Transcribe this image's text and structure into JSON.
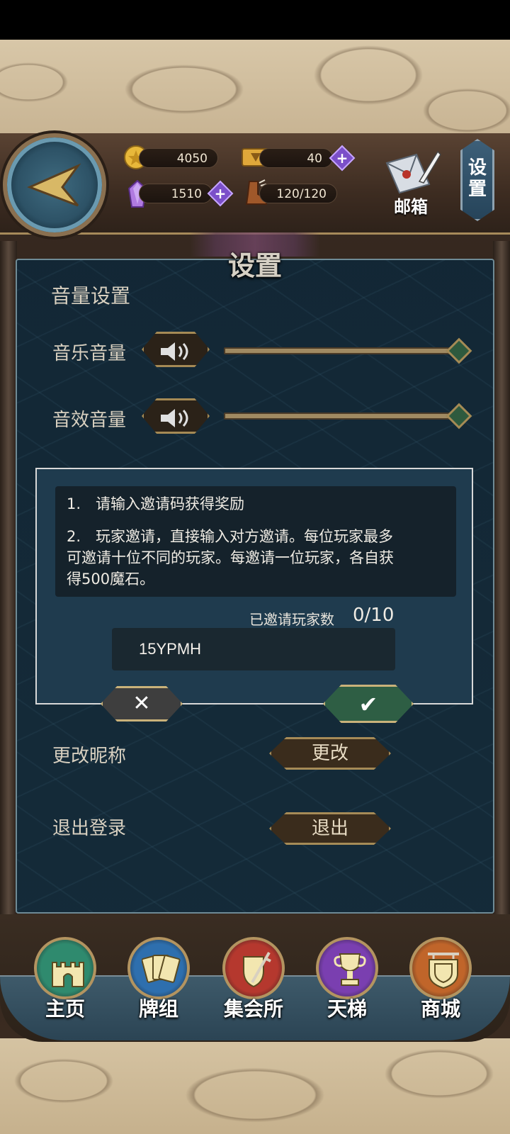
{
  "header": {
    "gold": "4050",
    "tickets": "40",
    "gems": "1510",
    "stamina": "120/120",
    "mailbox_label": "邮箱",
    "settings_label": "设置",
    "icons": {
      "back": "back-arrow-icon",
      "gold": "gold-coin-icon",
      "ticket": "ticket-icon",
      "gem": "crystal-gem-icon",
      "stamina": "boot-icon",
      "mail": "mail-envelope-icon",
      "plus": "plus-icon"
    }
  },
  "panel": {
    "title": "设置",
    "volume_section": "音量设置",
    "music_volume": "音乐音量",
    "sfx_volume": "音效音量",
    "music_level": 1.0,
    "sfx_level": 1.0,
    "change_nickname_label": "更改昵称",
    "change_button": "更改",
    "logout_label": "退出登录",
    "logout_button": "退出"
  },
  "invite_dialog": {
    "line1": "1.　请输入邀请码获得奖励",
    "line2a": "2.　玩家邀请，直接输入对方邀请。每位玩家最多",
    "line2b": "可邀请十位不同的玩家。每邀请一位玩家，各自获",
    "line2c": "得500魔石。",
    "invited_label": "已邀请玩家数",
    "invited_count": "0/10",
    "code_value": "15YPMH",
    "cancel_glyph": "✕",
    "confirm_glyph": "✔"
  },
  "nav": {
    "items": [
      {
        "label": "主页",
        "icon": "castle-icon",
        "color": "#2f8a6e"
      },
      {
        "label": "牌组",
        "icon": "cards-icon",
        "color": "#2e6fae"
      },
      {
        "label": "集会所",
        "icon": "shield-sword-icon",
        "color": "#b5382e"
      },
      {
        "label": "天梯",
        "icon": "trophy-icon",
        "color": "#7a3fb0"
      },
      {
        "label": "商城",
        "icon": "shop-sign-icon",
        "color": "#c0652a"
      }
    ]
  }
}
